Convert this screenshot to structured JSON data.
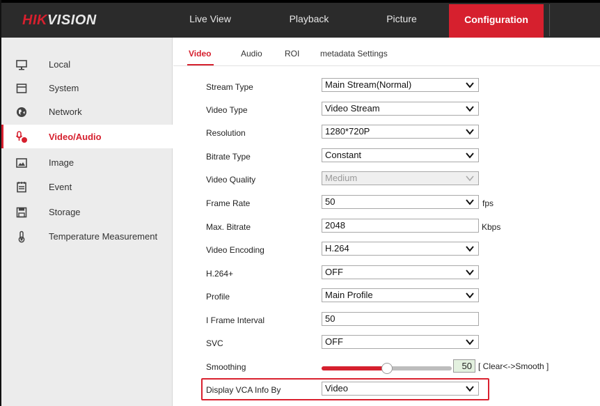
{
  "header": {
    "logo_red": "HIK",
    "logo_white": "VISION",
    "nav": {
      "live_view": "Live View",
      "playback": "Playback",
      "picture": "Picture",
      "configuration": "Configuration"
    },
    "accent_color": "#d6202e"
  },
  "sidebar": {
    "items": [
      {
        "label": "Local",
        "icon": "monitor-icon"
      },
      {
        "label": "System",
        "icon": "system-icon"
      },
      {
        "label": "Network",
        "icon": "globe-icon"
      },
      {
        "label": "Video/Audio",
        "icon": "video-audio-icon",
        "active": true
      },
      {
        "label": "Image",
        "icon": "image-icon"
      },
      {
        "label": "Event",
        "icon": "event-icon"
      },
      {
        "label": "Storage",
        "icon": "storage-icon"
      },
      {
        "label": "Temperature Measurement",
        "icon": "temperature-icon"
      }
    ]
  },
  "tabs": {
    "video": "Video",
    "audio": "Audio",
    "roi": "ROI",
    "metadata": "metadata Settings"
  },
  "form": {
    "stream_type": {
      "label": "Stream Type",
      "value": "Main Stream(Normal)"
    },
    "video_type": {
      "label": "Video Type",
      "value": "Video Stream"
    },
    "resolution": {
      "label": "Resolution",
      "value": "1280*720P"
    },
    "bitrate_type": {
      "label": "Bitrate Type",
      "value": "Constant"
    },
    "video_quality": {
      "label": "Video Quality",
      "value": "Medium"
    },
    "frame_rate": {
      "label": "Frame Rate",
      "value": "50",
      "unit": "fps"
    },
    "max_bitrate": {
      "label": "Max. Bitrate",
      "value": "2048",
      "unit": "Kbps"
    },
    "video_encoding": {
      "label": "Video Encoding",
      "value": "H.264"
    },
    "h264_plus": {
      "label": "H.264+",
      "value": "OFF"
    },
    "profile": {
      "label": "Profile",
      "value": "Main Profile"
    },
    "i_frame_interval": {
      "label": "I Frame Interval",
      "value": "50"
    },
    "svc": {
      "label": "SVC",
      "value": "OFF"
    },
    "smoothing": {
      "label": "Smoothing",
      "value": "50",
      "fraction": 0.5,
      "hint": "[ Clear<->Smooth ]"
    },
    "display_vca": {
      "label": "Display VCA Info By",
      "value": "Video"
    }
  }
}
